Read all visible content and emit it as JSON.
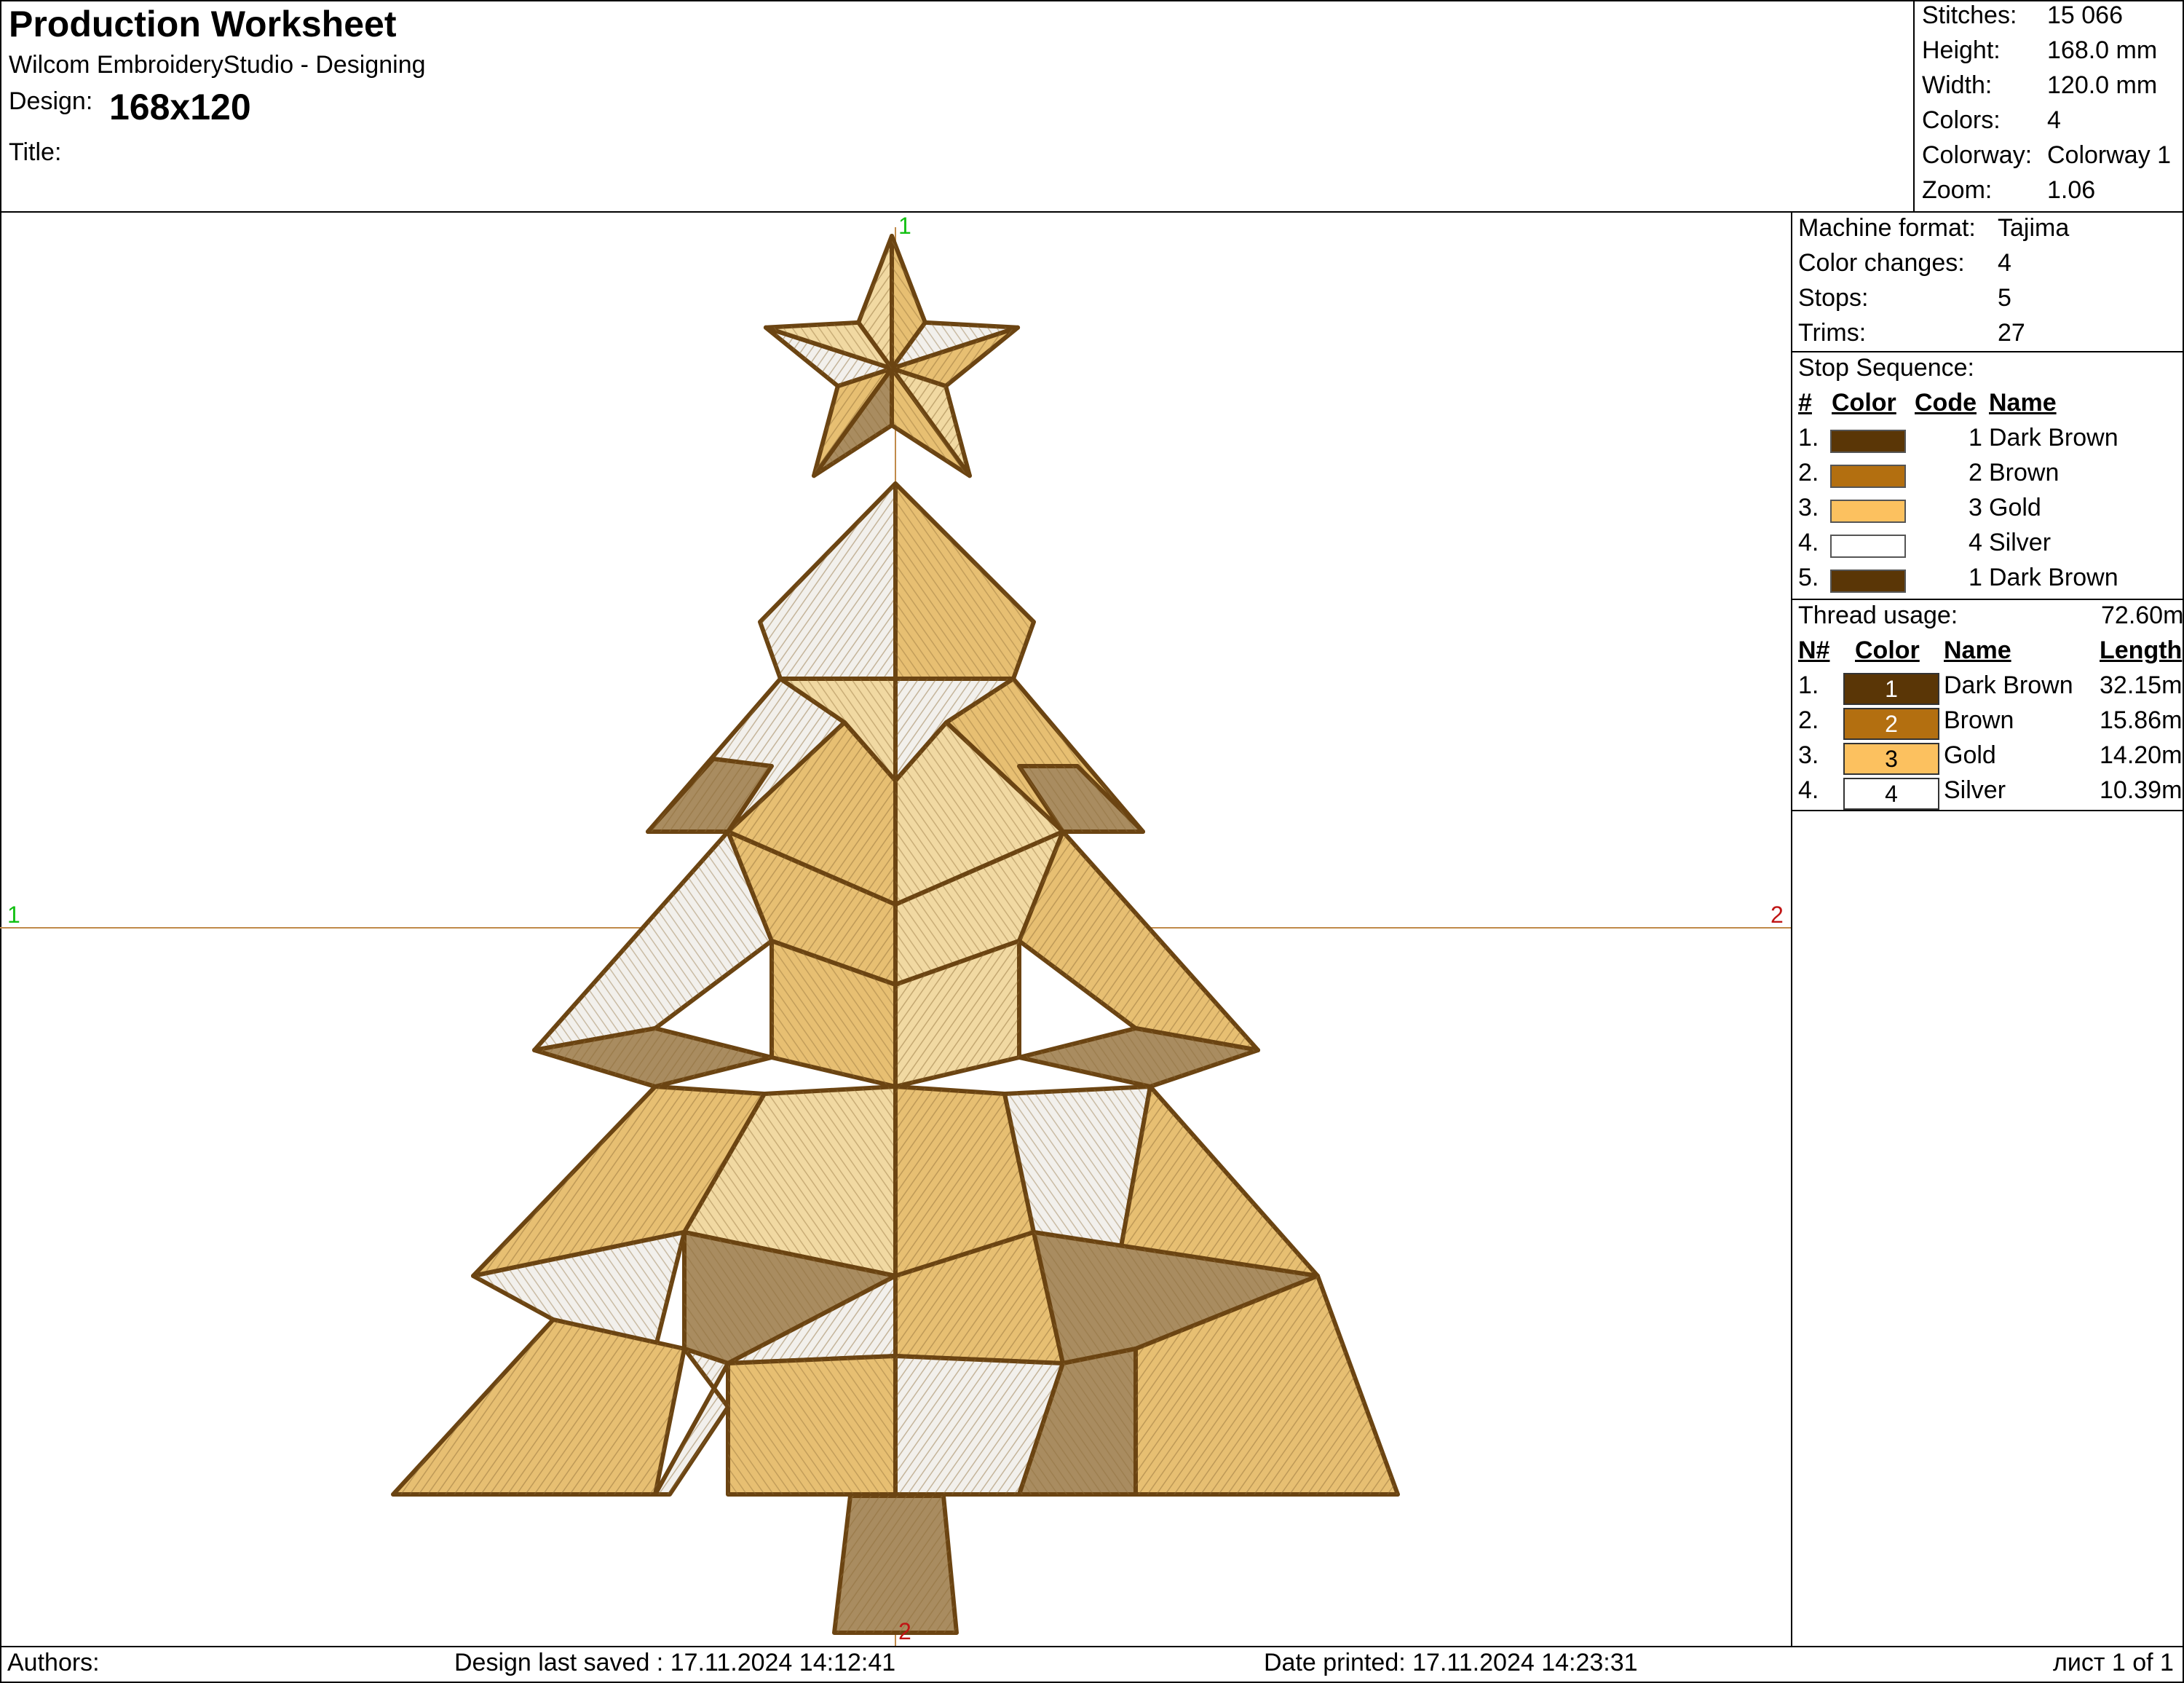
{
  "header": {
    "title": "Production Worksheet",
    "app": "Wilcom EmbroideryStudio - Designing",
    "design_label": "Design:",
    "design_value": "168x120",
    "title_label": "Title:"
  },
  "stats": [
    {
      "label": "Stitches:",
      "value": "15 066"
    },
    {
      "label": "Height:",
      "value": "168.0 mm"
    },
    {
      "label": "Width:",
      "value": "120.0 mm"
    },
    {
      "label": "Colors:",
      "value": "4"
    },
    {
      "label": "Colorway:",
      "value": "Colorway 1"
    },
    {
      "label": "Zoom:",
      "value": "1.06"
    }
  ],
  "machine": [
    {
      "label": "Machine format:",
      "value": "Tajima"
    },
    {
      "label": "Color changes:",
      "value": "4"
    },
    {
      "label": "Stops:",
      "value": "5"
    },
    {
      "label": "Trims:",
      "value": "27"
    }
  ],
  "stop_sequence": {
    "title": "Stop Sequence:",
    "headers": {
      "num": "#",
      "color": "Color",
      "code": "Code",
      "name": "Name"
    },
    "rows": [
      {
        "num": "1.",
        "color": "#5a3606",
        "code": "1",
        "name": "Dark Brown"
      },
      {
        "num": "2.",
        "color": "#b36f10",
        "code": "2",
        "name": "Brown"
      },
      {
        "num": "3.",
        "color": "#fcc15f",
        "code": "3",
        "name": "Gold"
      },
      {
        "num": "4.",
        "color": "#ffffff",
        "code": "4",
        "name": "Silver"
      },
      {
        "num": "5.",
        "color": "#5a3606",
        "code": "1",
        "name": "Dark Brown"
      }
    ]
  },
  "thread_usage": {
    "title": "Thread usage:",
    "total": "72.60m",
    "headers": {
      "num": "N#",
      "color": "Color",
      "name": "Name",
      "length": "Length"
    },
    "rows": [
      {
        "num": "1.",
        "color": "#5a3606",
        "text_color": "#ffffff",
        "code": "1",
        "name": "Dark Brown",
        "length": "32.15m"
      },
      {
        "num": "2.",
        "color": "#b36f10",
        "text_color": "#ffffff",
        "code": "2",
        "name": "Brown",
        "length": "15.86m"
      },
      {
        "num": "3.",
        "color": "#fcc15f",
        "text_color": "#000000",
        "code": "3",
        "name": "Gold",
        "length": "14.20m"
      },
      {
        "num": "4.",
        "color": "#ffffff",
        "text_color": "#000000",
        "code": "4",
        "name": "Silver",
        "length": "10.39m"
      }
    ]
  },
  "guides": {
    "top": "1",
    "bottom": "2",
    "left": "1",
    "right": "2"
  },
  "footer": {
    "authors": "Authors:",
    "saved": "Design last saved : 17.11.2024 14:12:41",
    "printed": "Date printed: 17.11.2024 14:23:31",
    "page": "лист 1 of 1"
  },
  "colors": {
    "dark_brown": "#5a3606",
    "brown": "#b36f10",
    "gold": "#fcc15f",
    "silver": "#ffffff",
    "fill_gold": "#e7bf72",
    "fill_light": "#f1d9a2",
    "fill_tan": "#a98c60",
    "fill_silver": "#f2f0ec",
    "outline": "#6b4412",
    "guide_line": "#c08a4a"
  }
}
